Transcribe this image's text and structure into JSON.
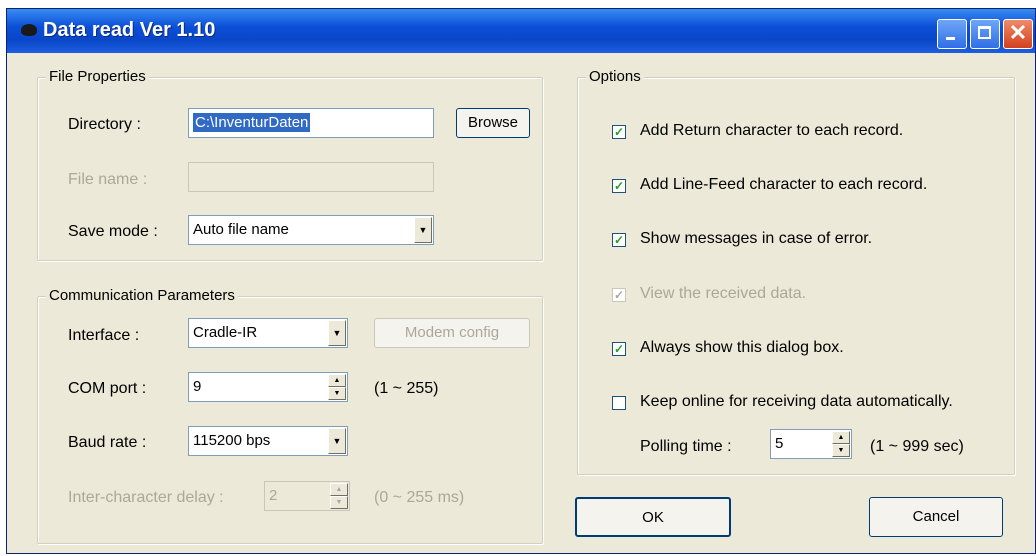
{
  "window": {
    "title": "Data read  Ver 1.10"
  },
  "file_properties": {
    "legend": "File Properties",
    "directory_label": "Directory :",
    "directory_value": "C:\\InventurDaten",
    "browse_label": "Browse",
    "filename_label": "File name :",
    "filename_value": "",
    "savemode_label": "Save mode :",
    "savemode_value": "Auto file name"
  },
  "communication": {
    "legend": "Communication Parameters",
    "interface_label": "Interface :",
    "interface_value": "Cradle-IR",
    "modem_label": "Modem config",
    "com_label": "COM port :",
    "com_value": "9",
    "com_range": "(1 ~ 255)",
    "baud_label": "Baud rate :",
    "baud_value": "115200 bps",
    "delay_label": "Inter-character delay :",
    "delay_value": "2",
    "delay_range": "(0 ~ 255 ms)"
  },
  "options": {
    "legend": "Options",
    "items": [
      {
        "label": "Add Return character to each record.",
        "checked": true,
        "enabled": true
      },
      {
        "label": "Add Line-Feed character to each record.",
        "checked": true,
        "enabled": true
      },
      {
        "label": "Show messages in case of error.",
        "checked": true,
        "enabled": true
      },
      {
        "label": "View the received data.",
        "checked": true,
        "enabled": false
      },
      {
        "label": "Always show this dialog box.",
        "checked": true,
        "enabled": true
      },
      {
        "label": "Keep online for receiving data automatically.",
        "checked": false,
        "enabled": true
      }
    ],
    "polling_label": "Polling time :",
    "polling_value": "5",
    "polling_range": "(1 ~ 999 sec)"
  },
  "buttons": {
    "ok_label": "OK",
    "cancel_label": "Cancel"
  },
  "colors": {
    "title_bar": "#0a46c8",
    "dialog_bg": "#ece9d8",
    "selection": "#316ac5",
    "check_mark": "#21a121"
  }
}
